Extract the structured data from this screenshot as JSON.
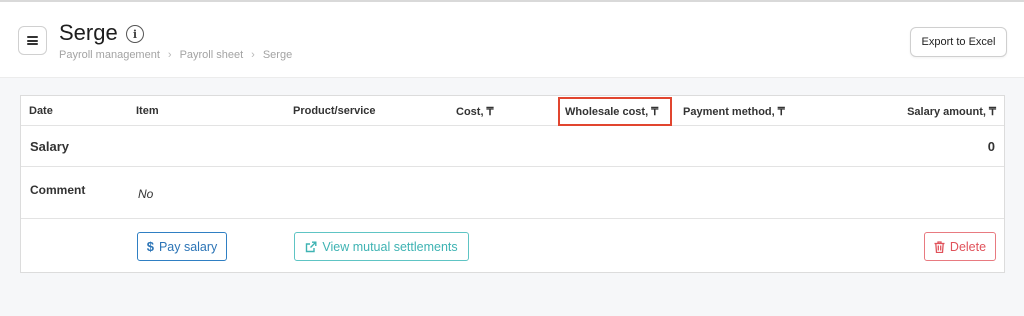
{
  "header": {
    "title": "Serge",
    "info_icon": "info-icon",
    "breadcrumb": [
      "Payroll management",
      "Payroll sheet",
      "Serge"
    ],
    "export_label": "Export to Excel",
    "menu_icon": "hamburger-menu-icon"
  },
  "table": {
    "columns": [
      "Date",
      "Item",
      "Product/service",
      "Cost, ₸",
      "Wholesale cost, ₸",
      "Payment method, ₸",
      "Salary amount, ₸"
    ],
    "highlighted_column": "Wholesale cost, ₸",
    "salary_label": "Salary",
    "salary_value": "0",
    "comment_label": "Comment",
    "comment_value": "No"
  },
  "actions": {
    "pay_label": "Pay salary",
    "view_label": "View mutual settlements",
    "delete_label": "Delete",
    "pay_icon": "dollar-icon",
    "view_icon": "external-link-icon",
    "delete_icon": "trash-icon"
  },
  "colors": {
    "highlight": "#e1452f",
    "pay": "#2b74b6",
    "view": "#3eb3b3",
    "delete": "#e0525a"
  }
}
